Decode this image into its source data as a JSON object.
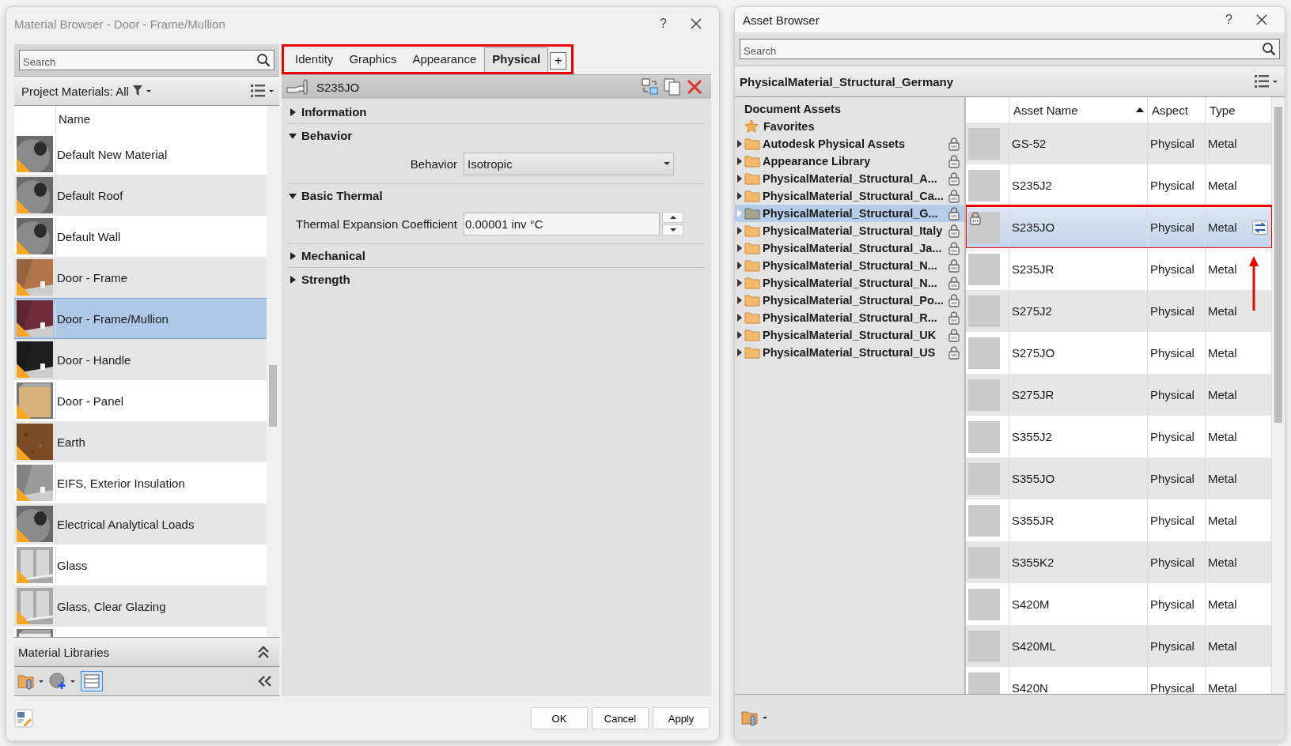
{
  "material_browser": {
    "title": "Material Browser - Door - Frame/Mullion",
    "help": "?",
    "search": {
      "placeholder": "Search"
    },
    "filter_label": "Project Materials: All",
    "list_header": "Name",
    "materials": [
      {
        "name": "Default New Material",
        "selected": false,
        "warning": true,
        "thumb": {
          "kind": "sphere",
          "color": "#8a8a8a"
        }
      },
      {
        "name": "Default Roof",
        "selected": false,
        "warning": true,
        "thumb": {
          "kind": "sphere",
          "color": "#8a8a8a"
        }
      },
      {
        "name": "Default Wall",
        "selected": false,
        "warning": true,
        "thumb": {
          "kind": "sphere",
          "color": "#8a8a8a"
        }
      },
      {
        "name": "Door - Frame",
        "selected": false,
        "warning": true,
        "thumb": {
          "kind": "wall",
          "color": "#b0764a"
        }
      },
      {
        "name": "Door - Frame/Mullion",
        "selected": true,
        "warning": true,
        "thumb": {
          "kind": "wall",
          "color": "#6e2d38"
        }
      },
      {
        "name": "Door - Handle",
        "selected": false,
        "warning": true,
        "thumb": {
          "kind": "wall",
          "color": "#1e1e1e"
        }
      },
      {
        "name": "Door - Panel",
        "selected": false,
        "warning": true,
        "thumb": {
          "kind": "cube",
          "color": "#d8b47c"
        }
      },
      {
        "name": "Earth",
        "selected": false,
        "warning": true,
        "thumb": {
          "kind": "flat",
          "color": "#7a4a22"
        }
      },
      {
        "name": "EIFS, Exterior Insulation",
        "selected": false,
        "warning": true,
        "thumb": {
          "kind": "wall",
          "color": "#9a9a9a"
        }
      },
      {
        "name": "Electrical Analytical Loads",
        "selected": false,
        "warning": true,
        "thumb": {
          "kind": "sphere",
          "color": "#8a8a8a"
        }
      },
      {
        "name": "Glass",
        "selected": false,
        "warning": true,
        "thumb": {
          "kind": "glass",
          "color": "#a8a8a8"
        }
      },
      {
        "name": "Glass, Clear Glazing",
        "selected": false,
        "warning": true,
        "thumb": {
          "kind": "glass",
          "color": "#a8a8a8"
        }
      },
      {
        "selected": false,
        "thumb": {
          "kind": "cube",
          "color": "#eeeeee"
        }
      }
    ],
    "libraries_label": "Material Libraries",
    "tabs": [
      {
        "label": "Identity",
        "selected": false
      },
      {
        "label": "Graphics",
        "selected": false
      },
      {
        "label": "Appearance",
        "selected": false
      },
      {
        "label": "Physical",
        "selected": true
      }
    ],
    "add_tab": "+",
    "tabs_highlighted": true,
    "asset_name": "S235JO",
    "sections": [
      {
        "title": "Information",
        "expanded": false
      },
      {
        "title": "Behavior",
        "expanded": true,
        "fields": [
          {
            "kind": "dropdown",
            "label": "Behavior",
            "value": "Isotropic"
          }
        ]
      },
      {
        "title": "Basic Thermal",
        "expanded": true,
        "fields": [
          {
            "kind": "spinner",
            "label": "Thermal Expansion Coefficient",
            "value": "0.00001 inv °C"
          }
        ]
      },
      {
        "title": "Mechanical",
        "expanded": false
      },
      {
        "title": "Strength",
        "expanded": false
      }
    ],
    "buttons": [
      "OK",
      "Cancel",
      "Apply"
    ]
  },
  "asset_browser": {
    "title": "Asset Browser",
    "help": "?",
    "search": {
      "placeholder": "Search"
    },
    "library_title": "PhysicalMaterial_Structural_Germany",
    "tree": [
      {
        "kind": "heading",
        "label": "Document Assets"
      },
      {
        "kind": "favorites",
        "label": "Favorites"
      },
      {
        "kind": "folder",
        "label": "Autodesk Physical Assets",
        "selected": false,
        "locked": true
      },
      {
        "kind": "folder",
        "label": "Appearance Library",
        "selected": false,
        "locked": true
      },
      {
        "kind": "folder",
        "label": "PhysicalMaterial_Structural_A...",
        "selected": false,
        "locked": true
      },
      {
        "kind": "folder",
        "label": "PhysicalMaterial_Structural_Ca...",
        "selected": false,
        "locked": true
      },
      {
        "kind": "folder",
        "label": "PhysicalMaterial_Structural_G...",
        "selected": true,
        "locked": true
      },
      {
        "kind": "folder",
        "label": "PhysicalMaterial_Structural_Italy",
        "selected": false,
        "locked": true
      },
      {
        "kind": "folder",
        "label": "PhysicalMaterial_Structural_Ja...",
        "selected": false,
        "locked": true
      },
      {
        "kind": "folder",
        "label": "PhysicalMaterial_Structural_N...",
        "selected": false,
        "locked": true
      },
      {
        "kind": "folder",
        "label": "PhysicalMaterial_Structural_N...",
        "selected": false,
        "locked": true
      },
      {
        "kind": "folder",
        "label": "PhysicalMaterial_Structural_Po...",
        "selected": false,
        "locked": true
      },
      {
        "kind": "folder",
        "label": "PhysicalMaterial_Structural_R...",
        "selected": false,
        "locked": true
      },
      {
        "kind": "folder",
        "label": "PhysicalMaterial_Structural_UK",
        "selected": false,
        "locked": true
      },
      {
        "kind": "folder",
        "label": "PhysicalMaterial_Structural_US",
        "selected": false,
        "locked": true
      }
    ],
    "columns": [
      {
        "label": "Asset Name",
        "sorted": true
      },
      {
        "label": "Aspect",
        "sorted": false
      },
      {
        "label": "Type",
        "sorted": false
      }
    ],
    "rows": [
      {
        "name": "GS-52",
        "aspect": "Physical",
        "type": "Metal",
        "selected": false,
        "locked": false,
        "highlighted": false
      },
      {
        "name": "S235J2",
        "aspect": "Physical",
        "type": "Metal",
        "selected": false,
        "locked": false,
        "highlighted": false
      },
      {
        "name": "S235JO",
        "aspect": "Physical",
        "type": "Metal",
        "selected": true,
        "locked": true,
        "highlighted": true
      },
      {
        "name": "S235JR",
        "aspect": "Physical",
        "type": "Metal",
        "selected": false,
        "locked": false,
        "highlighted": false
      },
      {
        "name": "S275J2",
        "aspect": "Physical",
        "type": "Metal",
        "selected": false,
        "locked": false,
        "highlighted": false
      },
      {
        "name": "S275JO",
        "aspect": "Physical",
        "type": "Metal",
        "selected": false,
        "locked": false,
        "highlighted": false
      },
      {
        "name": "S275JR",
        "aspect": "Physical",
        "type": "Metal",
        "selected": false,
        "locked": false,
        "highlighted": false
      },
      {
        "name": "S355J2",
        "aspect": "Physical",
        "type": "Metal",
        "selected": false,
        "locked": false,
        "highlighted": false
      },
      {
        "name": "S355JO",
        "aspect": "Physical",
        "type": "Metal",
        "selected": false,
        "locked": false,
        "highlighted": false
      },
      {
        "name": "S355JR",
        "aspect": "Physical",
        "type": "Metal",
        "selected": false,
        "locked": false,
        "highlighted": false
      },
      {
        "name": "S355K2",
        "aspect": "Physical",
        "type": "Metal",
        "selected": false,
        "locked": false,
        "highlighted": false
      },
      {
        "name": "S420M",
        "aspect": "Physical",
        "type": "Metal",
        "selected": false,
        "locked": false,
        "highlighted": false
      },
      {
        "name": "S420ML",
        "aspect": "Physical",
        "type": "Metal",
        "selected": false,
        "locked": false,
        "highlighted": false
      },
      {
        "name": "S420N",
        "aspect": "Physical",
        "type": "Metal",
        "selected": false,
        "locked": false,
        "highlighted": false
      }
    ],
    "pointer_arrow": true
  }
}
